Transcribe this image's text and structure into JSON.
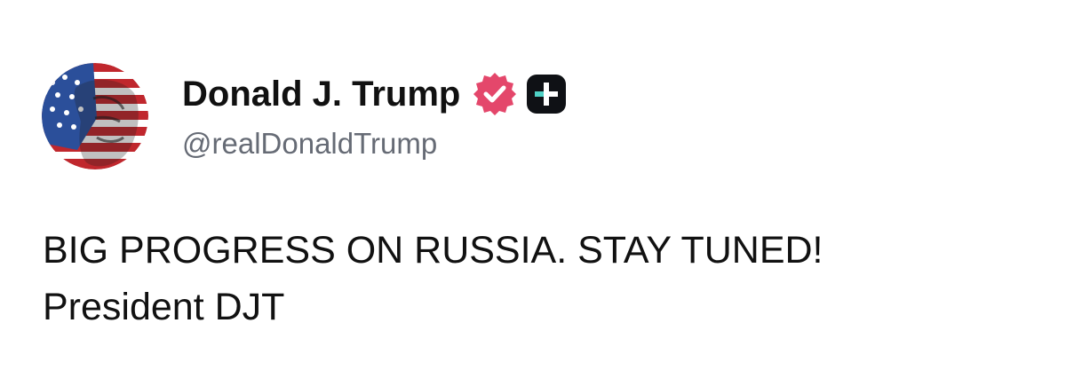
{
  "author": {
    "display_name": "Donald J. Trump",
    "handle": "@realDonaldTrump",
    "verified": true,
    "badges": [
      "verified-badge-icon",
      "plus-badge-icon"
    ],
    "avatar_icon": "flag-portrait-avatar"
  },
  "post": {
    "lines": [
      "BIG PROGRESS ON RUSSIA. STAY TUNED!",
      "President DJT"
    ]
  },
  "colors": {
    "background": "#ffffff",
    "name": "#111111",
    "handle": "#666b75",
    "verified_badge": "#e4476b",
    "plus_badge": "#0f1115",
    "plus_badge_accent": "#4fd1c5"
  }
}
